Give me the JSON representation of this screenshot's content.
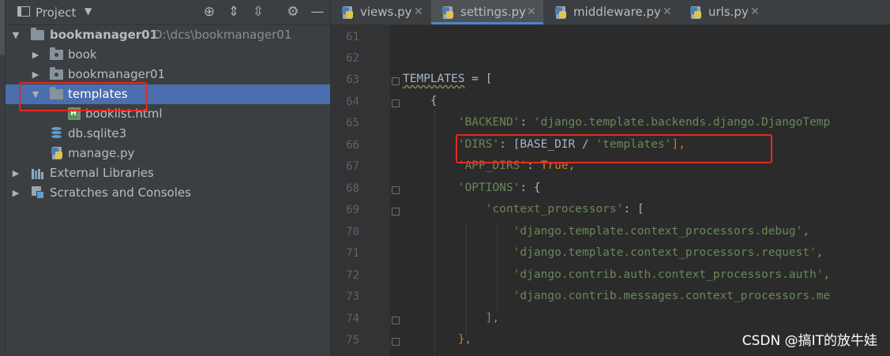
{
  "project_panel": {
    "title": "Project",
    "tree": [
      {
        "label": "bookmanager01",
        "path": "D:\\dcs\\bookmanager01"
      },
      {
        "label": "book"
      },
      {
        "label": "bookmanager01"
      },
      {
        "label": "templates"
      },
      {
        "label": "booklist.html"
      },
      {
        "label": "db.sqlite3"
      },
      {
        "label": "manage.py"
      },
      {
        "label": "External Libraries"
      },
      {
        "label": "Scratches and Consoles"
      }
    ]
  },
  "tabs": [
    {
      "label": "views.py"
    },
    {
      "label": "settings.py"
    },
    {
      "label": "middleware.py"
    },
    {
      "label": "urls.py"
    }
  ],
  "editor": {
    "line_numbers": [
      "61",
      "62",
      "63",
      "64",
      "65",
      "66",
      "67",
      "68",
      "69",
      "70",
      "71",
      "72",
      "73",
      "74",
      "75"
    ],
    "lines": {
      "l63a": "TEMPLATES",
      "l63b": " = [",
      "l64": "{",
      "l65a": "'BACKEND'",
      "l65b": ": ",
      "l65c": "'django.template.backends.django.DjangoTemp",
      "l66a": "'DIRS'",
      "l66b": ": [BASE_DIR / ",
      "l66c": "'templates'",
      "l66d": "],",
      "l67a": "'APP_DIRS'",
      "l67b": ": ",
      "l67c": "True",
      "l67d": ",",
      "l68a": "'OPTIONS'",
      "l68b": ": {",
      "l69a": "'context_processors'",
      "l69b": ": [",
      "l70a": "'django.template.context_processors.debug'",
      "l70b": ",",
      "l71a": "'django.template.context_processors.request'",
      "l71b": ",",
      "l72a": "'django.contrib.auth.context_processors.auth'",
      "l72b": ",",
      "l73a": "'django.contrib.messages.context_processors.me",
      "l74": "],",
      "l75": "},"
    }
  },
  "watermark": "CSDN @搞IT的放牛娃",
  "colors": {
    "selection": "#4b6eaf",
    "highlight_box": "#e8281e",
    "string": "#6a8759",
    "keyword": "#cc7832"
  }
}
